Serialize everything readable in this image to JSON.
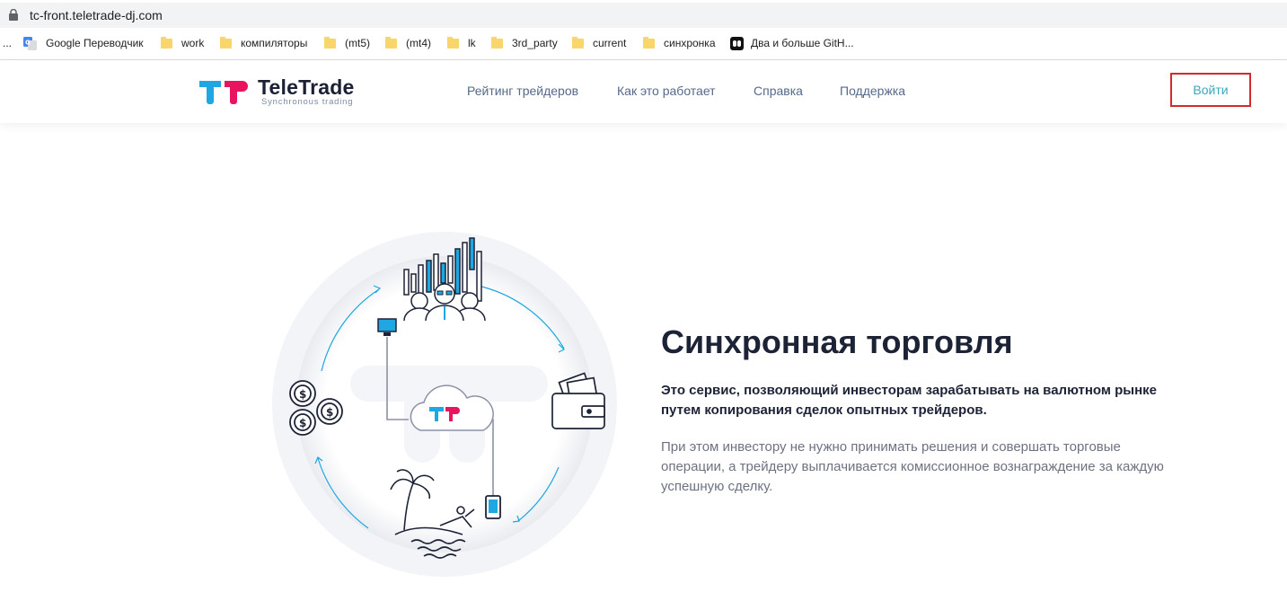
{
  "browser": {
    "url": "tc-front.teletrade-dj.com",
    "bookmarks": [
      {
        "label": "...",
        "icon": "overflow-icon"
      },
      {
        "label": "Google Переводчик",
        "icon": "google-translate-icon"
      },
      {
        "label": "work",
        "icon": "folder-icon"
      },
      {
        "label": "компиляторы",
        "icon": "folder-icon"
      },
      {
        "label": "(mt5)",
        "icon": "folder-icon"
      },
      {
        "label": "(mt4)",
        "icon": "folder-icon"
      },
      {
        "label": "lk",
        "icon": "folder-icon"
      },
      {
        "label": "3rd_party",
        "icon": "folder-icon"
      },
      {
        "label": "current",
        "icon": "folder-icon"
      },
      {
        "label": "синхронка",
        "icon": "folder-icon"
      },
      {
        "label": "Два и больше GitH...",
        "icon": "github-icon"
      }
    ]
  },
  "header": {
    "brand": "TeleTrade",
    "tagline": "Synchronous trading",
    "nav": [
      "Рейтинг трейдеров",
      "Как это работает",
      "Справка",
      "Поддержка"
    ],
    "login_label": "Войти"
  },
  "hero": {
    "title": "Синхронная торговля",
    "lead": "Это сервис, позволяющий инвесторам зарабатывать на валютном рынке путем копирования сделок опытных трейдеров.",
    "text": "При этом инвестору не нужно принимать решения и совершать торговые операции, а трейдеру выплачивается комиссионное вознаграждение за каждую успешную сделку."
  },
  "colors": {
    "brand_blue": "#1ea7e0",
    "brand_pink": "#e8145f",
    "dark": "#1d2336",
    "nav": "#55698a",
    "login_text": "#3aa8be",
    "highlight": "#d22b2b"
  }
}
